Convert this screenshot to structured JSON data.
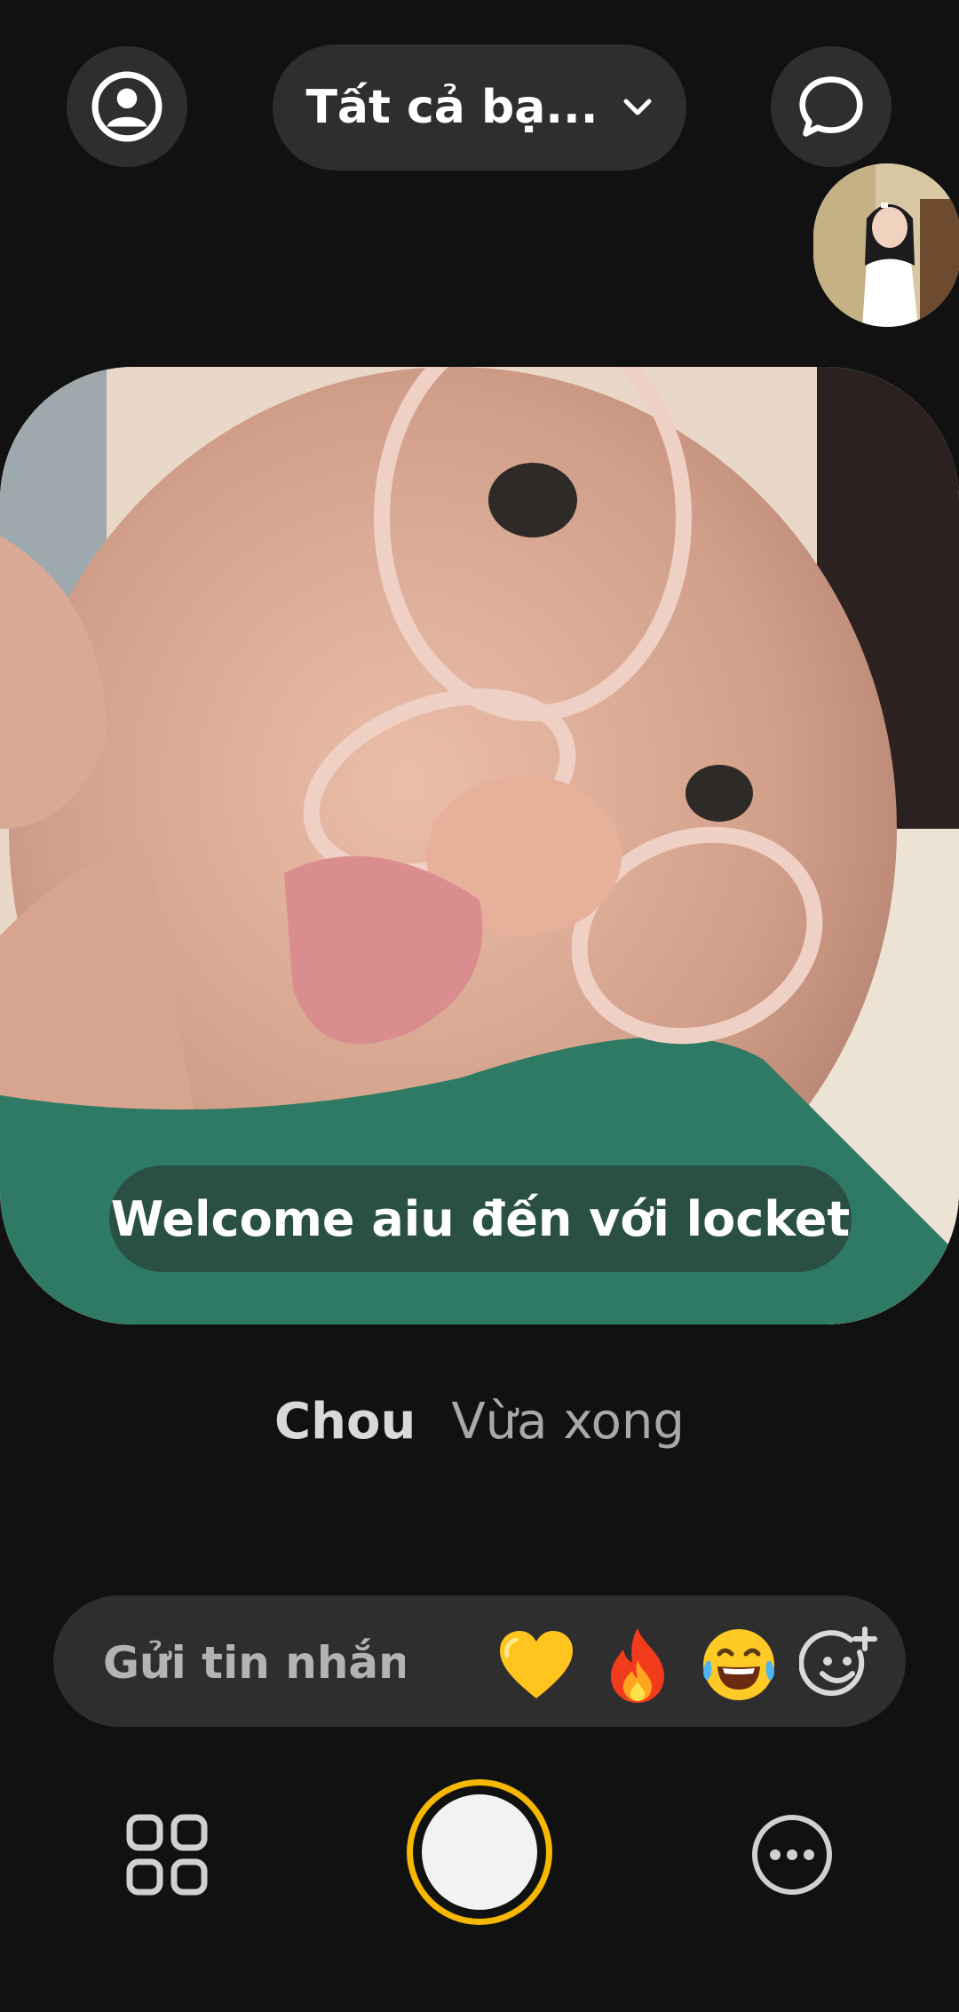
{
  "header": {
    "friends_filter_label": "Tất cả bạ..."
  },
  "post": {
    "caption": "Welcome aiu đến với locket",
    "sender_name": "Chou",
    "sent_time": "Vừa xong"
  },
  "composer": {
    "placeholder": "Gửi tin nhắn...",
    "reactions": [
      "💛",
      "🔥",
      "😂"
    ]
  },
  "icons": {
    "profile": "profile-icon",
    "filter_chevron": "chevron-down-icon",
    "chat": "chat-bubble-icon",
    "add_reaction": "add-emoji-icon",
    "gallery": "grid-icon",
    "more": "more-icon"
  },
  "colors": {
    "background": "#111111",
    "control": "#2e2e2e",
    "shutter_ring": "#f5b700"
  }
}
